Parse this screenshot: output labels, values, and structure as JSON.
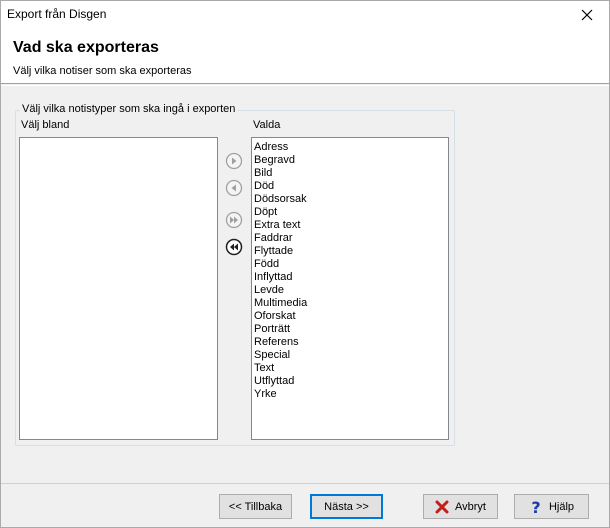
{
  "window": {
    "title": "Export från Disgen"
  },
  "header": {
    "title": "Vad ska exporteras",
    "subtitle": "Välj vilka notiser som ska exporteras"
  },
  "group": {
    "legend": "Välj vilka notistyper som ska ingå i exporten",
    "available_label": "Välj bland",
    "selected_label": "Valda",
    "available_items": [],
    "selected_items": [
      "Adress",
      "Begravd",
      "Bild",
      "Död",
      "Dödsorsak",
      "Döpt",
      "Extra text",
      "Faddrar",
      "Flyttade",
      "Född",
      "Inflyttad",
      "Levde",
      "Multimedia",
      "Oforskat",
      "Porträtt",
      "Referens",
      "Special",
      "Text",
      "Utflyttad",
      "Yrke"
    ]
  },
  "buttons": {
    "back": "<< Tillbaka",
    "next": "Nästa >>",
    "cancel": "Avbryt",
    "help": "Hjälp"
  },
  "colors": {
    "cancel_icon": "#c0201a",
    "help_icon": "#1e3aa8",
    "disabled_arrow": "#a0a0a0",
    "enabled_arrow": "#202020"
  }
}
